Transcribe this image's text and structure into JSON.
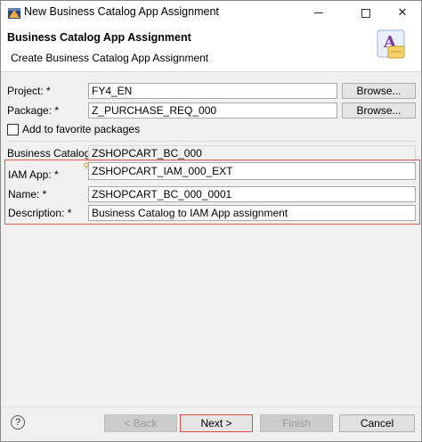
{
  "window": {
    "title": "New Business Catalog App Assignment"
  },
  "header": {
    "title": "Business Catalog App Assignment",
    "subtitle": "Create Business Catalog App Assignment"
  },
  "form": {
    "project": {
      "label": "Project: *",
      "value": "FY4_EN",
      "browse_label": "Browse..."
    },
    "package": {
      "label": "Package: *",
      "value": "Z_PURCHASE_REQ_000",
      "browse_label": "Browse..."
    },
    "favorite": {
      "label": "Add to favorite packages",
      "checked": false
    },
    "business_catalog": {
      "label": "Business Catalog: *",
      "value": "ZSHOPCART_BC_000"
    },
    "iam_app": {
      "label": "IAM App: *",
      "value": "ZSHOPCART_IAM_000_EXT"
    },
    "name": {
      "label": "Name: *",
      "value": "ZSHOPCART_BC_000_0001"
    },
    "description": {
      "label": "Description: *",
      "value": "Business Catalog to IAM App assignment"
    }
  },
  "footer": {
    "help": "?",
    "back_label": "< Back",
    "next_label": "Next >",
    "finish_label": "Finish",
    "cancel_label": "Cancel"
  },
  "colors": {
    "highlight": "#e05a5a",
    "dialog_bg": "#f0f0f0"
  }
}
